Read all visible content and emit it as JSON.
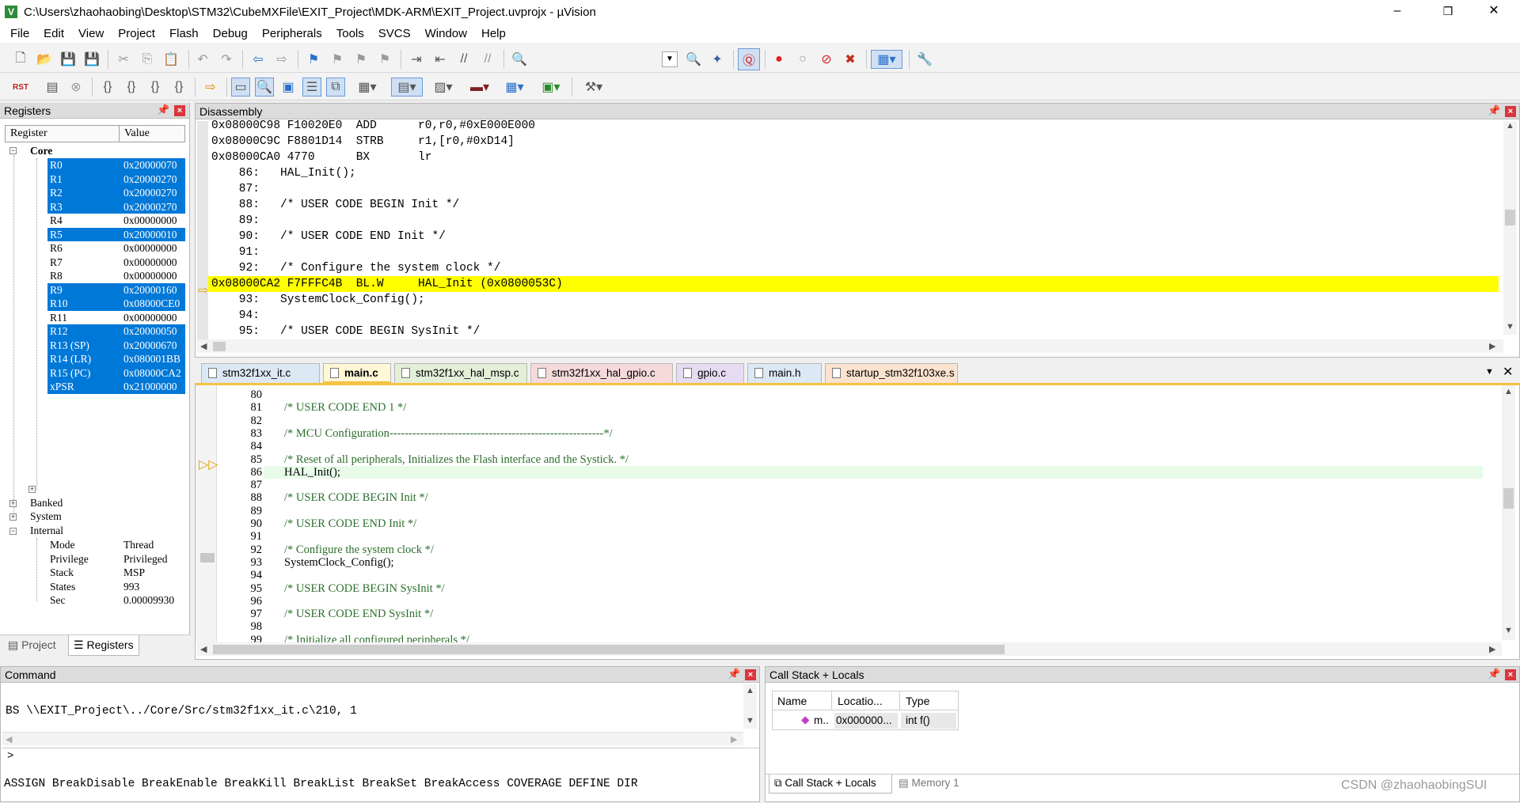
{
  "window": {
    "title": "C:\\Users\\zhaohaobing\\Desktop\\STM32\\CubeMXFile\\EXIT_Project\\MDK-ARM\\EXIT_Project.uvprojx - µVision",
    "minimize": "–",
    "restore": "❐",
    "close": "✕"
  },
  "menu": [
    "File",
    "Edit",
    "View",
    "Project",
    "Flash",
    "Debug",
    "Peripherals",
    "Tools",
    "SVCS",
    "Window",
    "Help"
  ],
  "registers": {
    "title": "Registers",
    "col_register": "Register",
    "col_value": "Value",
    "core_label": "Core",
    "core": [
      {
        "name": "R0",
        "value": "0x20000070",
        "selected": true
      },
      {
        "name": "R1",
        "value": "0x20000270",
        "selected": true
      },
      {
        "name": "R2",
        "value": "0x20000270",
        "selected": true
      },
      {
        "name": "R3",
        "value": "0x20000270",
        "selected": true
      },
      {
        "name": "R4",
        "value": "0x00000000",
        "selected": false
      },
      {
        "name": "R5",
        "value": "0x20000010",
        "selected": true
      },
      {
        "name": "R6",
        "value": "0x00000000",
        "selected": false
      },
      {
        "name": "R7",
        "value": "0x00000000",
        "selected": false
      },
      {
        "name": "R8",
        "value": "0x00000000",
        "selected": false
      },
      {
        "name": "R9",
        "value": "0x20000160",
        "selected": true
      },
      {
        "name": "R10",
        "value": "0x08000CE0",
        "selected": true
      },
      {
        "name": "R11",
        "value": "0x00000000",
        "selected": false
      },
      {
        "name": "R12",
        "value": "0x20000050",
        "selected": true
      },
      {
        "name": "R13 (SP)",
        "value": "0x20000670",
        "selected": true
      },
      {
        "name": "R14 (LR)",
        "value": "0x080001BB",
        "selected": true
      },
      {
        "name": "R15 (PC)",
        "value": "0x08000CA2",
        "selected": true
      },
      {
        "name": "xPSR",
        "value": "0x21000000",
        "selected": true
      }
    ],
    "banked_label": "Banked",
    "system_label": "System",
    "internal_label": "Internal",
    "internal": [
      {
        "name": "Mode",
        "value": "Thread"
      },
      {
        "name": "Privilege",
        "value": "Privileged"
      },
      {
        "name": "Stack",
        "value": "MSP"
      },
      {
        "name": "States",
        "value": "993"
      },
      {
        "name": "Sec",
        "value": "0.00009930"
      }
    ],
    "tab_project": "Project",
    "tab_registers": "Registers"
  },
  "disassembly": {
    "title": "Disassembly",
    "lines": [
      "0x08000C98 F10020E0  ADD      r0,r0,#0xE000E000",
      "0x08000C9C F8801D14  STRB     r1,[r0,#0xD14]",
      "0x08000CA0 4770      BX       lr",
      "    86:   HAL_Init();",
      "    87:",
      "    88:   /* USER CODE BEGIN Init */",
      "    89:",
      "    90:   /* USER CODE END Init */",
      "    91:",
      "    92:   /* Configure the system clock */",
      "0x08000CA2 F7FFFC4B  BL.W     HAL_Init (0x0800053C)",
      "    93:   SystemClock_Config();",
      "    94:",
      "    95:   /* USER CODE BEGIN SysInit */"
    ],
    "current_index": 10
  },
  "editor_tabs": [
    {
      "label": "stm32f1xx_it.c",
      "color": "#dde8f5",
      "active": false
    },
    {
      "label": "main.c",
      "color": "#fff7d6",
      "active": true
    },
    {
      "label": "stm32f1xx_hal_msp.c",
      "color": "#e3f0d8",
      "active": false
    },
    {
      "label": "stm32f1xx_hal_gpio.c",
      "color": "#f6dada",
      "active": false
    },
    {
      "label": "gpio.c",
      "color": "#e6dcf2",
      "active": false
    },
    {
      "label": "main.h",
      "color": "#dde8f5",
      "active": false
    },
    {
      "label": "startup_stm32f103xe.s",
      "color": "#fbe3cf",
      "active": false
    }
  ],
  "editor": {
    "lines": [
      {
        "num": "80",
        "text": ""
      },
      {
        "num": "81",
        "text": "/* USER CODE END 1 */",
        "comment": true
      },
      {
        "num": "82",
        "text": ""
      },
      {
        "num": "83",
        "text": "/* MCU Configuration--------------------------------------------------------*/",
        "comment": true
      },
      {
        "num": "84",
        "text": ""
      },
      {
        "num": "85",
        "text": "/* Reset of all peripherals, Initializes the Flash interface and the Systick. */",
        "comment": true
      },
      {
        "num": "86",
        "text": "HAL_Init();",
        "comment": false
      },
      {
        "num": "87",
        "text": ""
      },
      {
        "num": "88",
        "text": "/* USER CODE BEGIN Init */",
        "comment": true
      },
      {
        "num": "89",
        "text": ""
      },
      {
        "num": "90",
        "text": "/* USER CODE END Init */",
        "comment": true
      },
      {
        "num": "91",
        "text": ""
      },
      {
        "num": "92",
        "text": "/* Configure the system clock */",
        "comment": true
      },
      {
        "num": "93",
        "text": "SystemClock_Config();",
        "comment": false
      },
      {
        "num": "94",
        "text": ""
      },
      {
        "num": "95",
        "text": "/* USER CODE BEGIN SysInit */",
        "comment": true
      },
      {
        "num": "96",
        "text": ""
      },
      {
        "num": "97",
        "text": "/* USER CODE END SysInit */",
        "comment": true
      },
      {
        "num": "98",
        "text": ""
      },
      {
        "num": "99",
        "text": "/* Initialize all configured peripherals */",
        "comment": true
      }
    ],
    "current_line_index": 6
  },
  "command": {
    "title": "Command",
    "output": "BS \\\\EXIT_Project\\../Core/Src/stm32f1xx_it.c\\210, 1",
    "prompt": ">",
    "hints": "ASSIGN BreakDisable BreakEnable BreakKill BreakList BreakSet BreakAccess COVERAGE DEFINE DIR"
  },
  "callstack": {
    "title": "Call Stack + Locals",
    "col_name": "Name",
    "col_location": "Locatio...",
    "col_type": "Type",
    "row_name": "m..",
    "row_location": "0x000000...",
    "row_type": "int f()",
    "tab_callstack": "Call Stack + Locals",
    "tab_memory": "Memory 1"
  },
  "watermark": "CSDN @zhaohaobingSUI"
}
